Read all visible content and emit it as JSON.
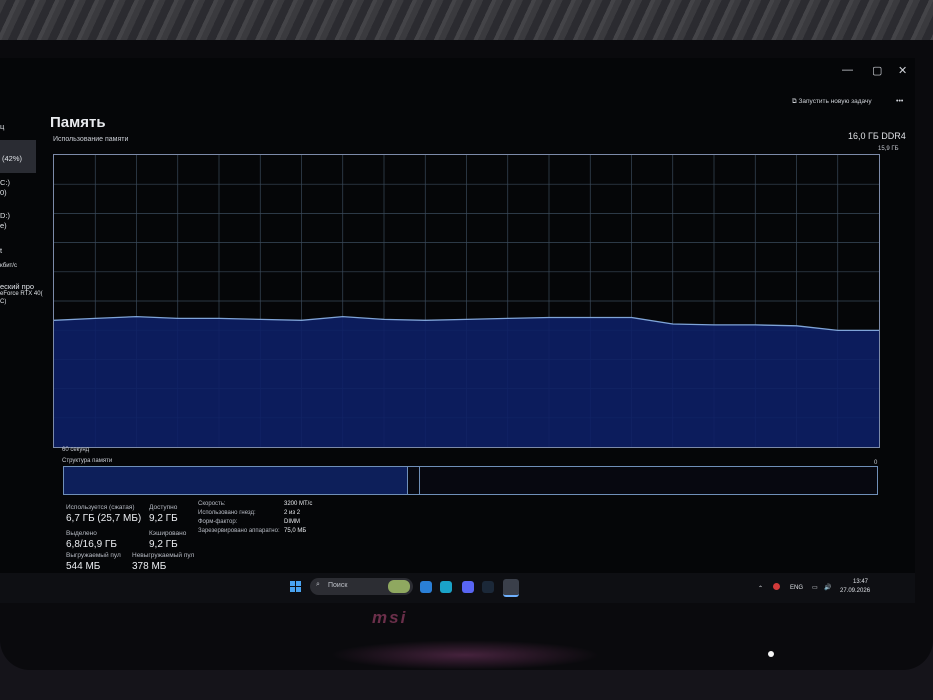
{
  "window": {
    "controls": [
      "—",
      "▢",
      "✕"
    ]
  },
  "header": {
    "run_task_label": "Запустить новую задачу",
    "more_label": "•••"
  },
  "page": {
    "title": "Память",
    "usage_label": "Использование памяти",
    "spec": "16,0 ГБ DDR4",
    "max_value": "15,9 ГБ",
    "time_label": "60 секунд",
    "zero_label": "0",
    "structure_label": "Структура памяти",
    "structure_zero": "0"
  },
  "sidebar_fragments": [
    "ц",
    "(42%)",
    "C:)",
    "0)",
    "D:)",
    "e)",
    "t",
    "кбит/с",
    "еский про",
    "eForce RTX 40(",
    "C)"
  ],
  "stats": {
    "in_use_label": "Используется (сжатая)",
    "in_use_value": "6,7 ГБ (25,7 МБ)",
    "available_label": "Доступно",
    "available_value": "9,2 ГБ",
    "committed_label": "Выделено",
    "committed_value": "6,8/16,9 ГБ",
    "cached_label": "Кэшировано",
    "cached_value": "9,2 ГБ",
    "paged_label": "Выгружаемый пул",
    "paged_value": "544 МБ",
    "nonpaged_label": "Невыгружаемый пул",
    "nonpaged_value": "378 МБ"
  },
  "specs": {
    "speed_label": "Скорость:",
    "speed_value": "3200 MT/c",
    "slots_label": "Использовано гнезд:",
    "slots_value": "2 из 2",
    "form_label": "Форм-фактор:",
    "form_value": "DIMM",
    "reserved_label": "Зарезервировано аппаратно:",
    "reserved_value": "75,0 МБ"
  },
  "taskbar": {
    "search_placeholder": "Поиск",
    "lang": "ENG",
    "time": "13:47",
    "date": "27.09.2026"
  },
  "monitor": {
    "brand": "msi"
  },
  "colors": {
    "fill": "#0d1f66",
    "line": "#7fa4d8",
    "grid": "#3a4a5a"
  },
  "chart_data": {
    "type": "area",
    "title": "Использование памяти",
    "xlabel": "60 секунд",
    "ylabel": "",
    "ylim": [
      0,
      15.9
    ],
    "x": [
      60,
      57,
      54,
      51,
      48,
      45,
      42,
      39,
      36,
      33,
      30,
      27,
      24,
      21,
      18,
      15,
      12,
      9,
      6,
      3,
      0
    ],
    "values": [
      6.9,
      7.0,
      7.1,
      7.0,
      7.0,
      6.95,
      6.9,
      7.1,
      6.95,
      6.9,
      6.95,
      7.0,
      7.05,
      7.05,
      7.05,
      6.7,
      6.65,
      6.65,
      6.6,
      6.35,
      6.35
    ]
  }
}
